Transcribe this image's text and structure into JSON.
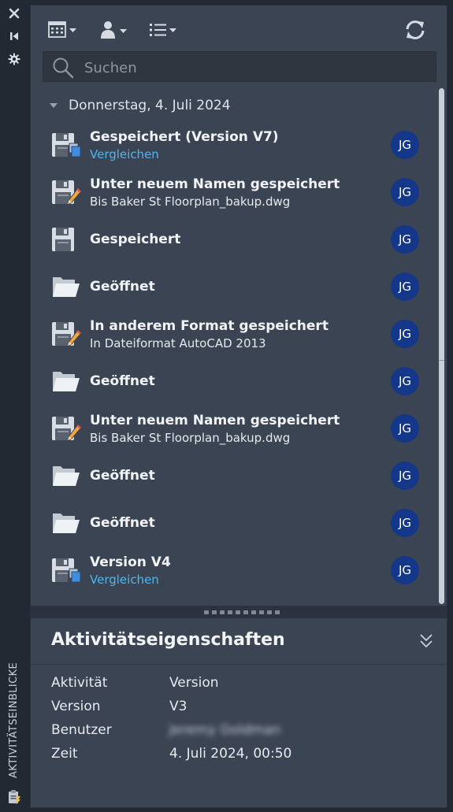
{
  "sidebar_title": "AKTIVITÄTSEINBLICKE",
  "sidebar_icons": [
    "close-icon",
    "pin-icon",
    "settings-icon",
    "activity-insights-icon"
  ],
  "toolbar": {
    "buttons": [
      "calendar-filter-icon",
      "user-filter-icon",
      "list-filter-icon",
      "refresh-icon"
    ]
  },
  "search": {
    "placeholder": "Suchen",
    "value": ""
  },
  "date_group": "Donnerstag, 4. Juli 2024",
  "activities": [
    {
      "icon": "save-version-icon",
      "title": "Gespeichert (Version V7)",
      "subtitle": "Vergleichen",
      "subtitle_is_link": true,
      "user": "JG"
    },
    {
      "icon": "save-as-icon",
      "title": "Unter neuem Namen gespeichert",
      "subtitle": "Bis Baker St Floorplan_bakup.dwg",
      "subtitle_is_link": false,
      "user": "JG"
    },
    {
      "icon": "save-icon",
      "title": "Gespeichert",
      "subtitle": "",
      "subtitle_is_link": false,
      "user": "JG"
    },
    {
      "icon": "open-folder-icon",
      "title": "Geöffnet",
      "subtitle": "",
      "subtitle_is_link": false,
      "user": "JG"
    },
    {
      "icon": "save-as-icon",
      "title": "In anderem Format gespeichert",
      "subtitle": "In Dateiformat AutoCAD 2013",
      "subtitle_is_link": false,
      "user": "JG"
    },
    {
      "icon": "open-folder-icon",
      "title": "Geöffnet",
      "subtitle": "",
      "subtitle_is_link": false,
      "user": "JG"
    },
    {
      "icon": "save-as-icon",
      "title": "Unter neuem Namen gespeichert",
      "subtitle": "Bis Baker St Floorplan_bakup.dwg",
      "subtitle_is_link": false,
      "user": "JG"
    },
    {
      "icon": "open-folder-icon",
      "title": "Geöffnet",
      "subtitle": "",
      "subtitle_is_link": false,
      "user": "JG"
    },
    {
      "icon": "open-folder-icon",
      "title": "Geöffnet",
      "subtitle": "",
      "subtitle_is_link": false,
      "user": "JG"
    },
    {
      "icon": "save-version-icon",
      "title": "Version V4",
      "subtitle": "Vergleichen",
      "subtitle_is_link": true,
      "user": "JG"
    }
  ],
  "properties": {
    "title": "Aktivitätseigenschaften",
    "rows": [
      {
        "key": "Aktivität",
        "value": "Version",
        "blurred": false
      },
      {
        "key": "Version",
        "value": "V3",
        "blurred": false
      },
      {
        "key": "Benutzer",
        "value": "Jeremy Goldman",
        "blurred": true
      },
      {
        "key": "Zeit",
        "value": "4. Juli 2024, 00:50",
        "blurred": false
      }
    ]
  },
  "colors": {
    "panel_bg": "#3b4453",
    "app_bg": "#222933",
    "avatar_bg": "#14378a",
    "link": "#4fb6f0"
  }
}
